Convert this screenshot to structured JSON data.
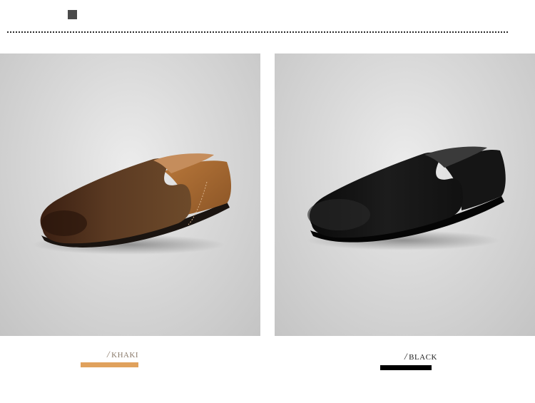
{
  "variants": [
    {
      "name": "KHAKI",
      "slash": "/",
      "label_color": "#8a7a6a",
      "bar_color": "#e0a15c",
      "shoe_icon": "shoe-khaki-icon"
    },
    {
      "name": "BLACK",
      "slash": "/",
      "label_color": "#222222",
      "bar_color": "#000000",
      "shoe_icon": "shoe-black-icon"
    }
  ]
}
